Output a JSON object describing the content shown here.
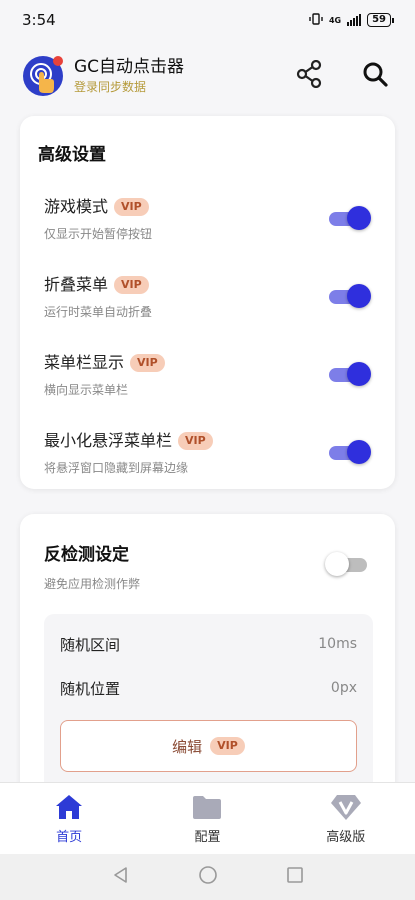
{
  "status_bar": {
    "time": "3:54",
    "network": "4G",
    "battery": "59"
  },
  "app": {
    "title": "GC自动点击器",
    "subtitle": "登录同步数据"
  },
  "advanced": {
    "title": "高级设置",
    "items": [
      {
        "label": "游戏模式",
        "badge": "VIP",
        "desc": "仅显示开始暂停按钮",
        "enabled": true
      },
      {
        "label": "折叠菜单",
        "badge": "VIP",
        "desc": "运行时菜单自动折叠",
        "enabled": true
      },
      {
        "label": "菜单栏显示",
        "badge": "VIP",
        "desc": "横向显示菜单栏",
        "enabled": true
      },
      {
        "label": "最小化悬浮菜单栏",
        "badge": "VIP",
        "desc": "将悬浮窗口隐藏到屏幕边缘",
        "enabled": true
      }
    ]
  },
  "anti_detect": {
    "title": "反检测设定",
    "desc": "避免应用检测作弊",
    "enabled": false,
    "random_interval": {
      "label": "随机区间",
      "value": "10ms"
    },
    "random_position": {
      "label": "随机位置",
      "value": "0px"
    },
    "edit": {
      "label": "编辑",
      "badge": "VIP"
    }
  },
  "nav": {
    "home": "首页",
    "config": "配置",
    "premium": "高级版",
    "active": "home"
  },
  "colors": {
    "accent": "#2f2fdd",
    "vip_bg": "#f7cdb8",
    "vip_text": "#b0502a",
    "subtitle": "#b59a3a"
  }
}
